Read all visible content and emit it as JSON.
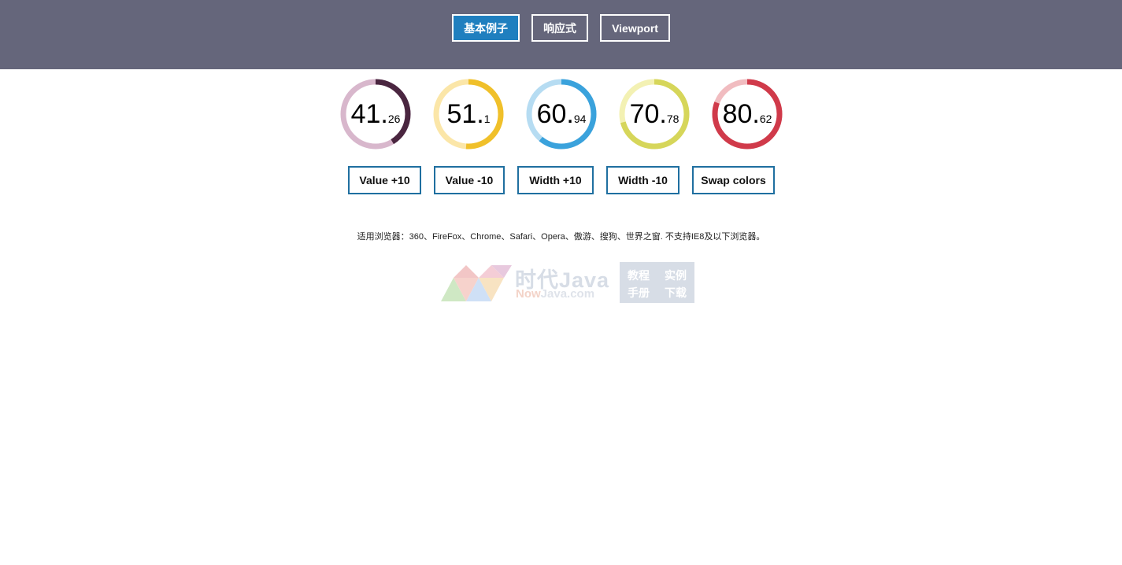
{
  "nav": {
    "buttons": [
      {
        "label": "基本例子",
        "active": true
      },
      {
        "label": "响应式",
        "active": false
      },
      {
        "label": "Viewport",
        "active": false
      }
    ]
  },
  "circles": [
    {
      "int": "41",
      "dec": "26",
      "value": 41.26,
      "color": "#4a2640",
      "track": "#d8b7cc"
    },
    {
      "int": "51",
      "dec": "1",
      "value": 51.1,
      "color": "#f0c02a",
      "track": "#fbe6a8"
    },
    {
      "int": "60",
      "dec": "94",
      "value": 60.94,
      "color": "#3aa2dc",
      "track": "#b6dcf2"
    },
    {
      "int": "70",
      "dec": "78",
      "value": 70.78,
      "color": "#d6d65a",
      "track": "#f3f1b3"
    },
    {
      "int": "80",
      "dec": "62",
      "value": 80.62,
      "color": "#d03a4a",
      "track": "#f1bcc0"
    }
  ],
  "controls": {
    "buttons": [
      {
        "label": "Value +10"
      },
      {
        "label": "Value -10"
      },
      {
        "label": "Width +10"
      },
      {
        "label": "Width -10"
      },
      {
        "label": "Swap colors"
      }
    ]
  },
  "support_text": "适用浏览器：360、FireFox、Chrome、Safari、Opera、傲游、搜狗、世界之窗. 不支持IE8及以下浏览器。",
  "logo": {
    "brand": "时代Java",
    "site_prefix": "Now",
    "site_suffix": "Java.com",
    "box": [
      "教程",
      "实例",
      "手册",
      "下载"
    ]
  }
}
